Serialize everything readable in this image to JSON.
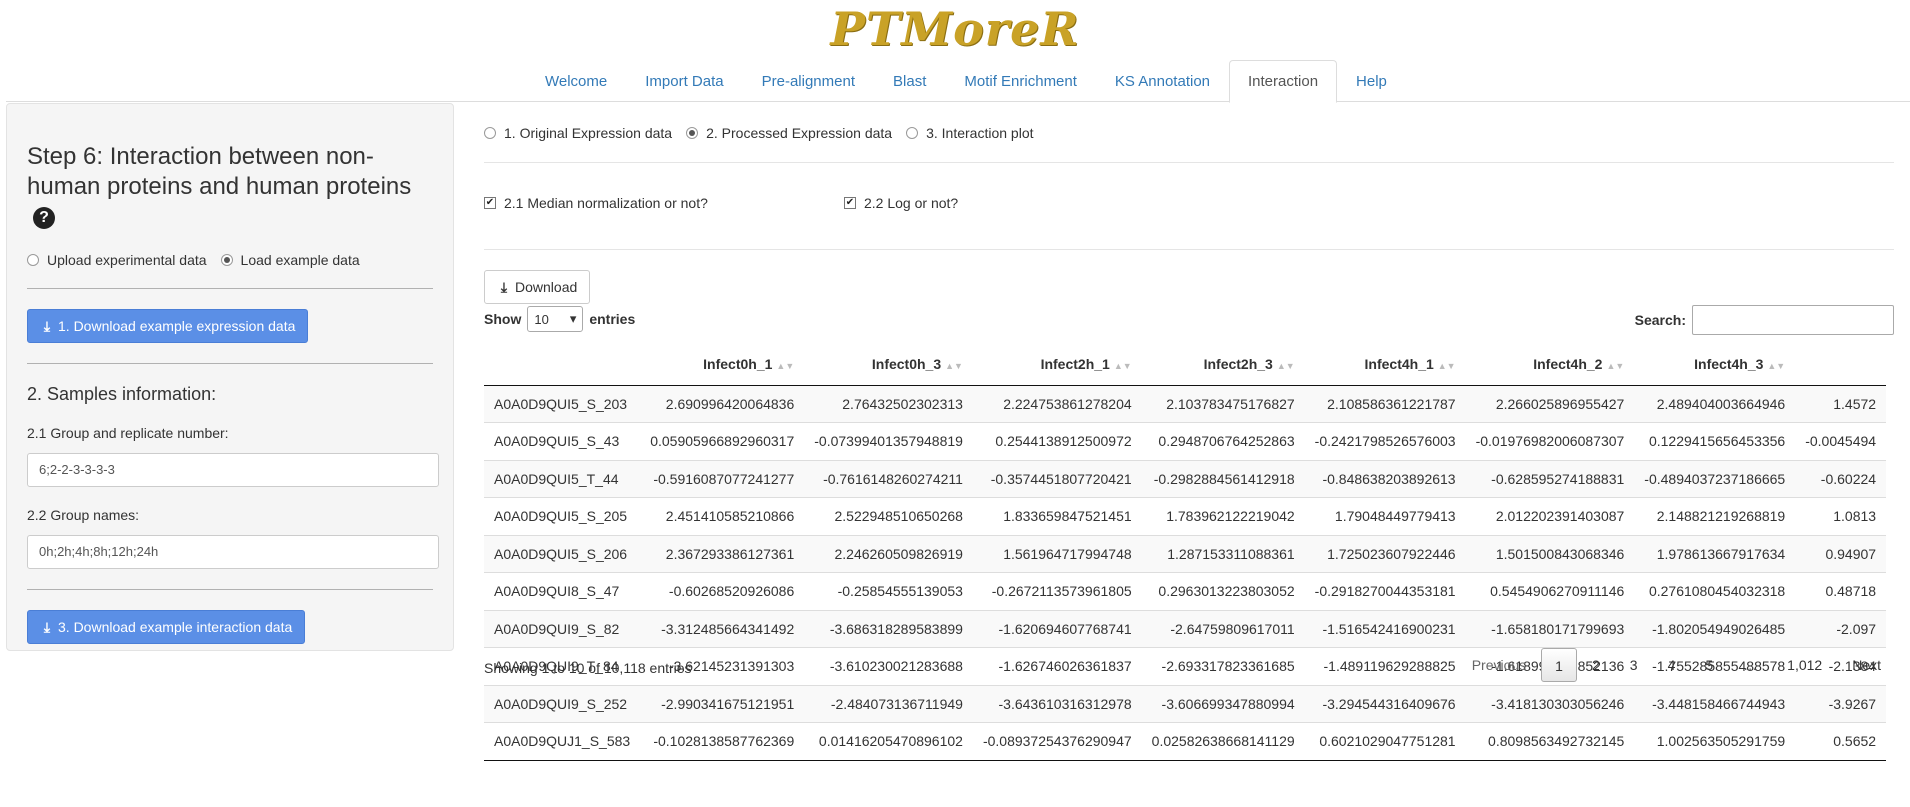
{
  "app": {
    "brand": "PTMoreR"
  },
  "nav": {
    "tabs": [
      {
        "label": "Welcome"
      },
      {
        "label": "Import Data"
      },
      {
        "label": "Pre-alignment"
      },
      {
        "label": "Blast"
      },
      {
        "label": "Motif Enrichment"
      },
      {
        "label": "KS Annotation"
      },
      {
        "label": "Interaction"
      },
      {
        "label": "Help"
      }
    ],
    "active": "Interaction"
  },
  "sidebar": {
    "title": "Step 6: Interaction between non-human proteins and human proteins",
    "help_icon": "question-circle-icon",
    "data_source": {
      "options": [
        "Upload experimental data",
        "Load example data"
      ],
      "selected": "Load example data"
    },
    "download_expression_label": "1. Download example expression data",
    "samples_title": "2. Samples information:",
    "group_replicate_label": "2.1 Group and replicate number:",
    "group_replicate_value": "6;2-2-3-3-3-3",
    "group_names_label": "2.2 Group names:",
    "group_names_value": "0h;2h;4h;8h;12h;24h",
    "download_interaction_label": "3. Download example interaction data"
  },
  "main": {
    "view_options": {
      "options": [
        "1. Original Expression data",
        "2. Processed Expression data",
        "3. Interaction plot"
      ],
      "selected": "2. Processed Expression data"
    },
    "median_norm_label": "2.1 Median normalization or not?",
    "median_norm_checked": true,
    "log_label": "2.2 Log or not?",
    "log_checked": true,
    "download_label": "Download",
    "show_label": "Show",
    "entries_label": "entries",
    "page_size": "10",
    "search_label": "Search:",
    "search_value": "",
    "table": {
      "columns": [
        "",
        "Infect0h_1",
        "Infect0h_3",
        "Infect2h_1",
        "Infect2h_3",
        "Infect4h_1",
        "Infect4h_2",
        "Infect4h_3",
        ""
      ],
      "rows": [
        [
          "A0A0D9QUI5_S_203",
          "2.690996420064836",
          "2.76432502302313",
          "2.224753861278204",
          "2.103783475176827",
          "2.108586361221787",
          "2.266025896955427",
          "2.489404003664946",
          "1.4572"
        ],
        [
          "A0A0D9QUI5_S_43",
          "0.05905966892960317",
          "-0.07399401357948819",
          "0.2544138912500972",
          "0.2948706764252863",
          "-0.2421798526576003",
          "-0.01976982006087307",
          "0.1229415656453356",
          "-0.0045494"
        ],
        [
          "A0A0D9QUI5_T_44",
          "-0.5916087077241277",
          "-0.7616148260274211",
          "-0.3574451807720421",
          "-0.2982884561412918",
          "-0.848638203892613",
          "-0.628595274188831",
          "-0.4894037237186665",
          "-0.60224"
        ],
        [
          "A0A0D9QUI5_S_205",
          "2.451410585210866",
          "2.522948510650268",
          "1.833659847521451",
          "1.783962122219042",
          "1.79048449779413",
          "2.012202391403087",
          "2.148821219268819",
          "1.0813"
        ],
        [
          "A0A0D9QUI5_S_206",
          "2.367293386127361",
          "2.246260509826919",
          "1.561964717994748",
          "1.287153311088361",
          "1.725023607922446",
          "1.501500843068346",
          "1.978613667917634",
          "0.94907"
        ],
        [
          "A0A0D9QUI8_S_47",
          "-0.60268520926086",
          "-0.25854555139053",
          "-0.2672113573961805",
          "0.2963013223803052",
          "-0.2918270044353181",
          "0.5454906270911146",
          "0.2761080454032318",
          "0.48718"
        ],
        [
          "A0A0D9QUI9_S_82",
          "-3.312485664341492",
          "-3.686318289583899",
          "-1.620694607768741",
          "-2.64759809617011",
          "-1.516542416900231",
          "-1.658180171799693",
          "-1.802054949026485",
          "-2.097"
        ],
        [
          "A0A0D9QUI9_T_84",
          "-3.62145231391303",
          "-3.610230021283688",
          "-1.626746026361837",
          "-2.693317823361685",
          "-1.489119629288825",
          "-1.618996258852136",
          "-1.755285855488578",
          "-2.1384"
        ],
        [
          "A0A0D9QUI9_S_252",
          "-2.990341675121951",
          "-2.484073136711949",
          "-3.643610316312978",
          "-3.606699347880994",
          "-3.294544316409676",
          "-3.418130303056246",
          "-3.448158466744943",
          "-3.9267"
        ],
        [
          "A0A0D9QUJ1_S_583",
          "-0.1028138587762369",
          "0.01416205470896102",
          "-0.08937254376290947",
          "0.02582638668141129",
          "0.6021029047751281",
          "0.8098563492732145",
          "1.002563505291759",
          "0.5652"
        ]
      ]
    },
    "info_text": "Showing 1 to 10 of 10,118 entries",
    "pagination": {
      "previous": "Previous",
      "pages": [
        "1",
        "2",
        "3",
        "4",
        "5",
        "…",
        "1,012"
      ],
      "current": "1",
      "next": "Next"
    }
  },
  "colors": {
    "brand": "#c9a227",
    "link": "#337ab7",
    "primary_button": "#5b8fe6"
  }
}
